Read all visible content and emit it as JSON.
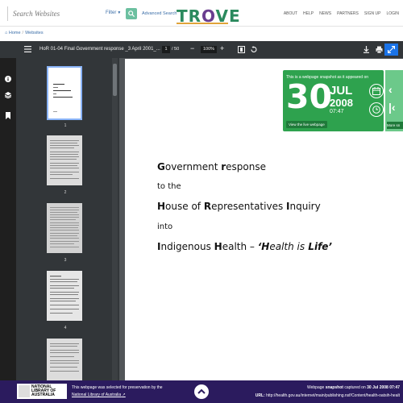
{
  "header": {
    "search_placeholder": "Search Websites",
    "filter_label": "Filter",
    "advanced_search": "Advanced Search",
    "logo": "TROVE",
    "nav": [
      "ABOUT",
      "HELP",
      "NEWS",
      "PARTNERS",
      "SIGN UP",
      "LOGIN"
    ]
  },
  "breadcrumb": {
    "home": "Home",
    "websites": "Websites"
  },
  "viewer": {
    "doc_title": "HoR 01-04 Final Government response _3 April 2001_...",
    "current_page": "1",
    "total_pages": "/ 50",
    "zoom": "100%",
    "thumb_numbers": [
      "1",
      "2",
      "3",
      "4"
    ]
  },
  "document": {
    "line1_parts": [
      [
        "G",
        "overnment "
      ],
      [
        "r",
        "esponse"
      ]
    ],
    "line2": "to the",
    "line3_parts": [
      [
        "H",
        "ouse of "
      ],
      [
        "R",
        "epresentatives "
      ],
      [
        "I",
        "nquiry"
      ]
    ],
    "line4": "into",
    "line5_a": "I",
    "line5_b": "ndigenous ",
    "line5_c": "H",
    "line5_d": "ealth – ",
    "line5_e": "‘",
    "line5_f": "H",
    "line5_g": "ealth ",
    "line5_h": "is",
    "line5_i": " L",
    "line5_j": "ife’"
  },
  "snapshot": {
    "heading": "This is a webpage snapshot as it appeared on",
    "day": "30",
    "month": "JUL",
    "year": "2008",
    "time": "07:47",
    "view_live": "View the live webpage",
    "more_label": "More sn"
  },
  "footer": {
    "nla_logo": "NATIONAL LIBRARY OF AUSTRALIA",
    "selected_text": "This webpage was selected for preservation by the",
    "nla_link": "National Library of Australia",
    "captured_prefix": "Webpage",
    "captured_bold": "snapshot",
    "captured_mid": "captured on",
    "captured_date": "30 Jul 2008 07:47",
    "url_label": "URL:",
    "url": "http://health.gov.au/internet/main/publishing.nsf/Content/health-oatsih-healt"
  },
  "colors": {
    "trove_green": "#2b8a5e",
    "trove_purple": "#6a3d8f",
    "snapshot_green": "#2ea24e",
    "footer_purple": "#2b1b5e",
    "pdf_toolbar": "#323639",
    "link_blue": "#3b6ea8"
  }
}
